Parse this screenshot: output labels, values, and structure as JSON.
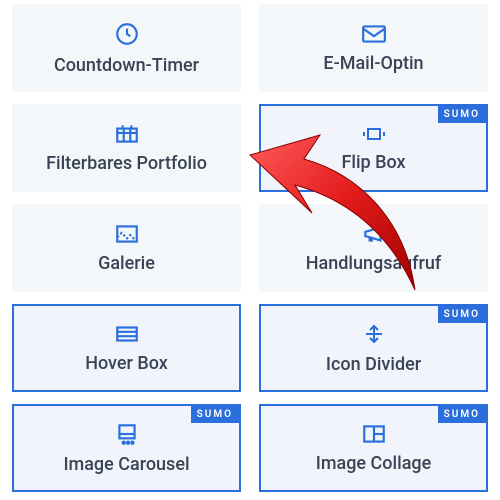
{
  "badge_text": "SUMO",
  "cards": [
    {
      "label": "Countdown-Timer",
      "icon": "clock-icon",
      "bordered": false,
      "badge": false
    },
    {
      "label": "E-Mail-Optin",
      "icon": "mail-icon",
      "bordered": false,
      "badge": false
    },
    {
      "label": "Filterbares Portfolio",
      "icon": "grid-icon",
      "bordered": false,
      "badge": false
    },
    {
      "label": "Flip Box",
      "icon": "flip-icon",
      "bordered": true,
      "badge": true
    },
    {
      "label": "Galerie",
      "icon": "image-icon",
      "bordered": false,
      "badge": false
    },
    {
      "label": "Handlungsaufruf",
      "icon": "megaphone-icon",
      "bordered": false,
      "badge": false
    },
    {
      "label": "Hover Box",
      "icon": "layout-icon",
      "bordered": true,
      "badge": false
    },
    {
      "label": "Icon Divider",
      "icon": "divider-icon",
      "bordered": true,
      "badge": true
    },
    {
      "label": "Image Carousel",
      "icon": "carousel-icon",
      "bordered": true,
      "badge": true
    },
    {
      "label": "Image Collage",
      "icon": "collage-icon",
      "bordered": true,
      "badge": true
    }
  ]
}
